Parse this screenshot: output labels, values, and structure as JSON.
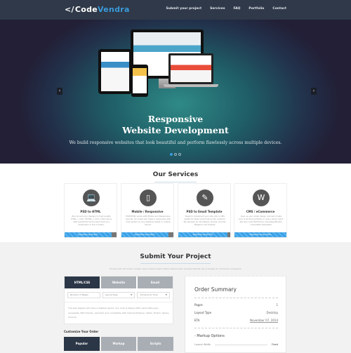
{
  "nav": {
    "logo_a": "Code",
    "logo_b": "Vendra",
    "links": [
      "Submit your project",
      "Services",
      "FAQ",
      "Portfolio",
      "Contact"
    ]
  },
  "hero": {
    "title_line1": "Responsive",
    "title_line2": "Website Development",
    "subtitle": "We build responsive websites that look beautiful and perform flawlessly across multiple devices.",
    "prev": "‹",
    "next": "›",
    "active_slide": 1,
    "slides": 3
  },
  "services": {
    "title": "Our Services",
    "cards": [
      {
        "icon": "laptop-icon",
        "glyph": "💻",
        "title": "PSD to HTML",
        "desc": "We convert your designs to high quality HTML + CSS / XHTML + CSS coded along with JavaScript by the best front end developers in the industry.",
        "bar": "Expertise Level 90%",
        "level": 0.9
      },
      {
        "icon": "mobile-icon",
        "glyph": "▯",
        "title": "Mobile / Responsive",
        "desc": "PSD/HTML works with Mobile and Responsive layouts. Our team will make a responsive site look perfect on any desktop, tablet or mobile device.",
        "bar": "Expertise Level 90%",
        "level": 0.9
      },
      {
        "icon": "pencil-icon",
        "glyph": "✎",
        "title": "PSD to Email Template",
        "desc": "Need to implement your site into a CMS platform? Need eCommerce? No problem. We develop for WordPress, Drupal, Joomla!, Magento and Shopify.",
        "bar": "Expertise Level 95%",
        "level": 0.95
      },
      {
        "icon": "wordpress-icon",
        "glyph": "W",
        "title": "CMS / eCommerce",
        "desc": "Give us your email design and we'll make sure it renders perfectly in every email client. We also code MailChimp, CampaignMonitor compatible templates.",
        "bar": "Expertise Level 100%",
        "level": 1.0
      }
    ]
  },
  "submit": {
    "title": "Submit Your Project",
    "subtitle": "Ut wisi enim ad minim veniam, quis nostrud exerci tation ullamcorper suscipit lobortis nisl ut aliquip ex commodo consequat.",
    "tabs": [
      "HTML/CSS",
      "Website",
      "Email"
    ],
    "fields": {
      "pages": "Number of Pages",
      "layout": "Layout Type",
      "turnaround": "Turnaround Time"
    },
    "note": "The web page(s) will have a desktop layout. Our code is always W3C valid, table-less, accessible, SEO friendly, semantic and compatible with Internet Explorer, Safari, Firefox, Opera, Chrome.",
    "customize": "Customize Your Order",
    "tabs2": [
      "Popular",
      "Markup",
      "Scripts"
    ]
  },
  "order": {
    "title": "Order Summary",
    "rows": [
      {
        "k": "Pages",
        "v": "1"
      },
      {
        "k": "Layout Type",
        "v": "Desktop"
      },
      {
        "k": "ETA",
        "v": "November 07, 2014"
      }
    ],
    "markup": "- Markup Options",
    "layout_width": "Layout Width",
    "layout_width_v": "Fixed"
  }
}
